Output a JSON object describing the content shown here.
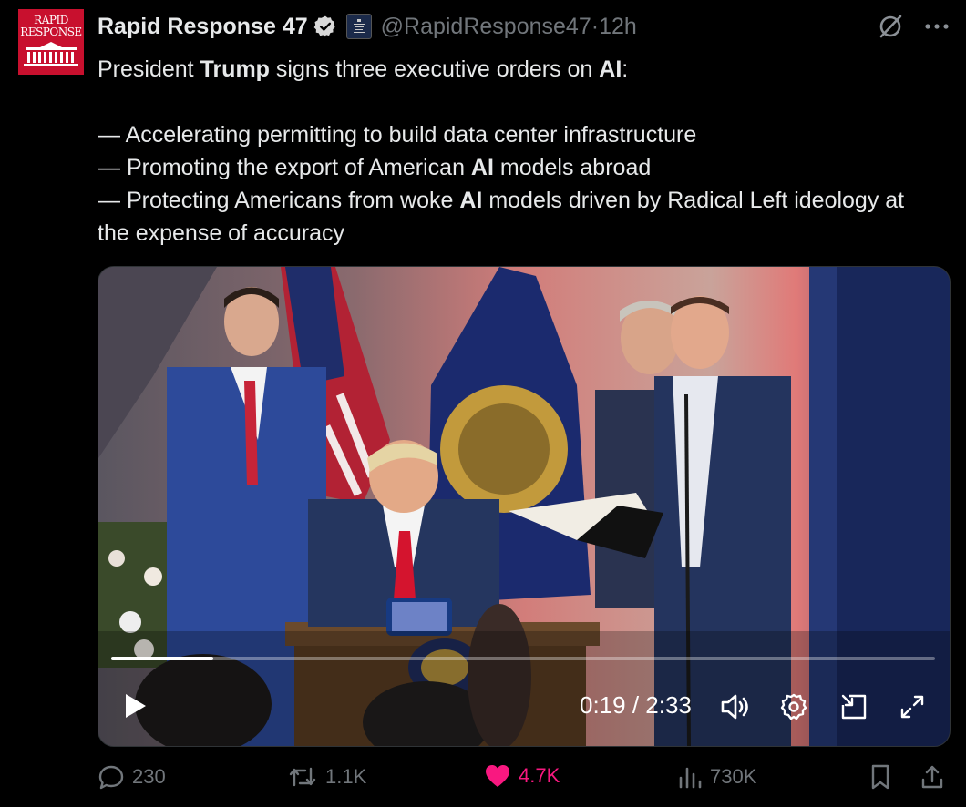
{
  "account": {
    "name": "Rapid Response 47",
    "handle": "@RapidResponse47",
    "separator": " · ",
    "time": "12h",
    "avatar_text_1": "RAPID",
    "avatar_text_2": "RESPONSE",
    "affiliation_badge_text": "THE WHITE HOUSE",
    "brand_color": "#c8102e"
  },
  "tweet": {
    "line1": {
      "a": "President ",
      "b": "Trump",
      "c": " signs three executive orders on ",
      "d": "AI",
      "e": ":"
    },
    "bullet1": "— Accelerating permitting to build data center infrastructure",
    "bullet2": {
      "a": "— Promoting the export of American ",
      "b": "AI",
      "c": " models abroad"
    },
    "bullet3": {
      "a": "— Protecting Americans from woke ",
      "b": "AI",
      "c": " models driven by Radical Left ideology at the expense of accuracy"
    }
  },
  "video": {
    "current_time": "0:19",
    "duration": "2:33",
    "time_separator": " / ",
    "progress_fraction": 0.124
  },
  "actions": {
    "replies": "230",
    "reposts": "1.1K",
    "likes": "4.7K",
    "views": "730K",
    "like_color": "#f91880",
    "muted_color": "#71767b"
  },
  "icons": [
    "verified-icon",
    "grok-icon",
    "more-icon",
    "play-icon",
    "volume-icon",
    "settings-icon",
    "pip-icon",
    "fullscreen-icon",
    "reply-icon",
    "repost-icon",
    "like-icon",
    "views-icon",
    "bookmark-icon",
    "share-icon"
  ]
}
